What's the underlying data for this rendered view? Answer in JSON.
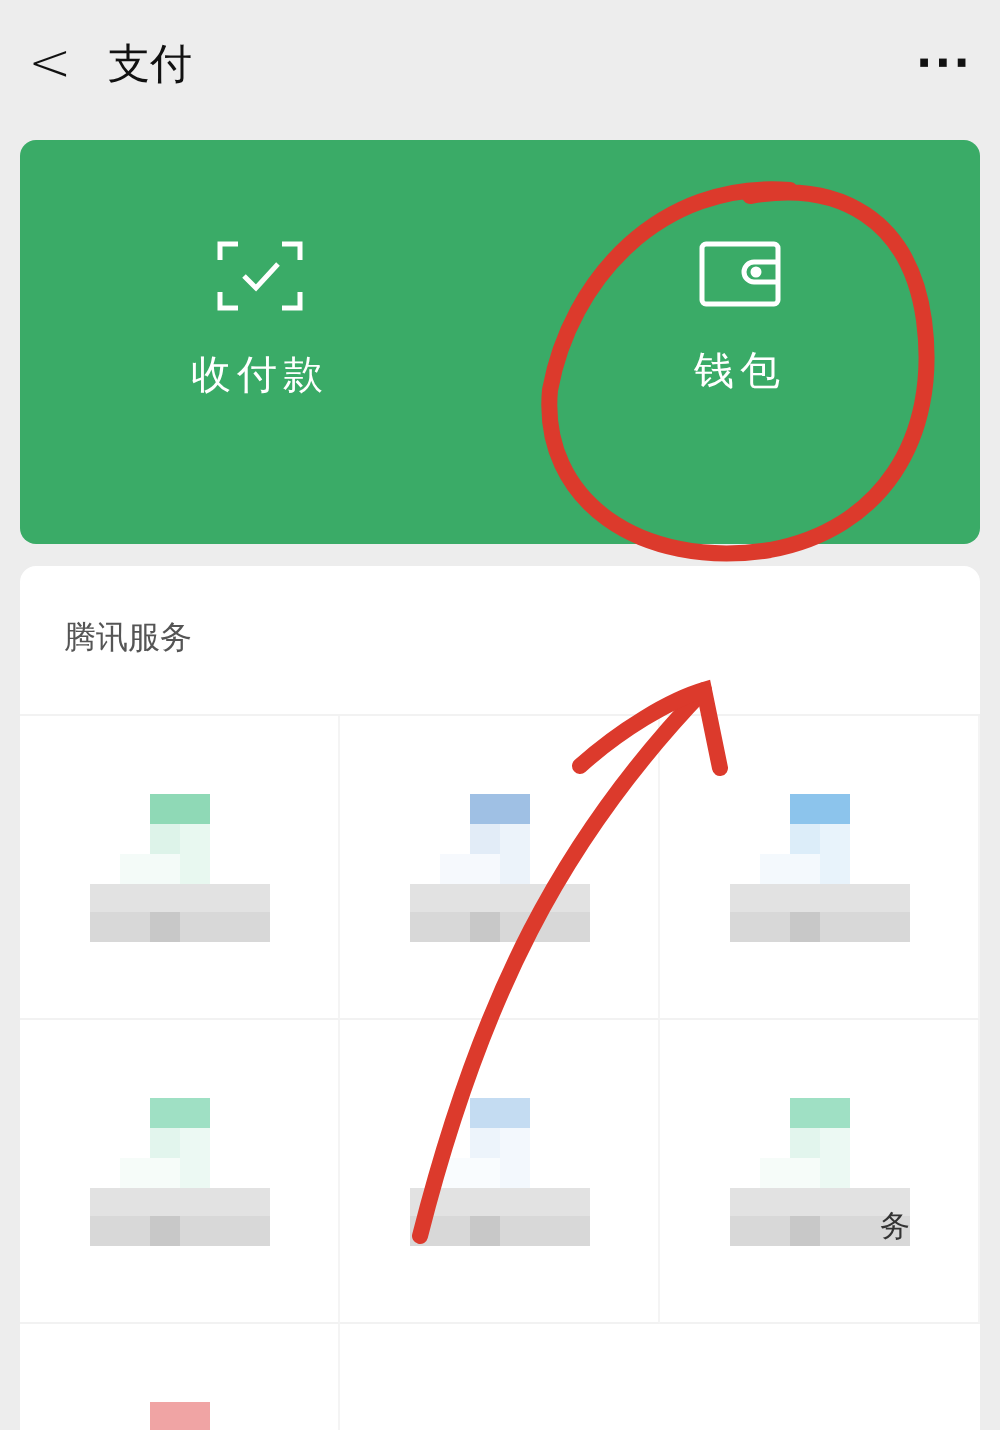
{
  "header": {
    "back": "<",
    "title": "支付",
    "more": "···"
  },
  "pay_card": {
    "items": [
      {
        "kind": "scan",
        "label": "收付款"
      },
      {
        "kind": "wallet",
        "label": "钱包"
      }
    ]
  },
  "services": {
    "title": "腾讯服务",
    "tiles": [
      {
        "color": "#8fd9b6"
      },
      {
        "color": "#9fc0e4"
      },
      {
        "color": "#8cc4ec"
      },
      {
        "color": "#9fe0c4"
      },
      {
        "color": "#c4dcf2"
      },
      {
        "color": "#9fe0c4",
        "label": "务"
      },
      {
        "color": "#f0a4a4"
      }
    ]
  }
}
